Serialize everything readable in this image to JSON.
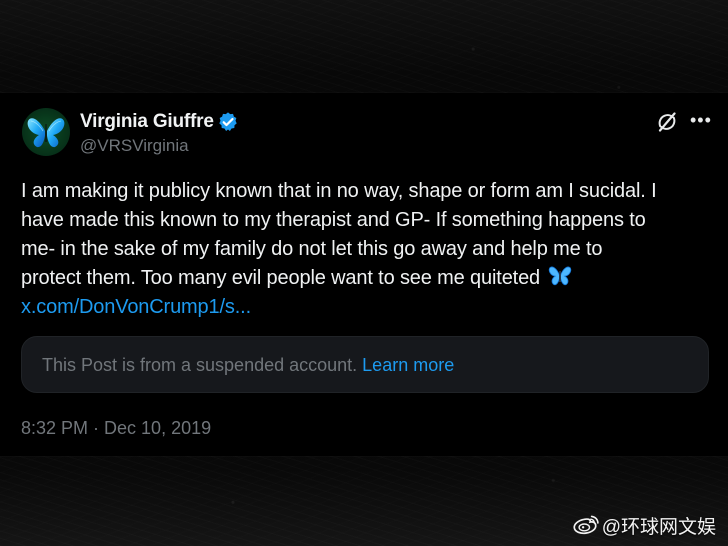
{
  "post": {
    "author": {
      "name": "Virginia Giuffre",
      "handle": "@VRSVirginia",
      "verified": true,
      "avatar_icon": "blue-butterfly-avatar"
    },
    "text_lines": [
      "I am making it publicy known that in no way, shape or form am I sucidal. I",
      "have made this known to my therapist and GP- If something happens to",
      "me- in the sake of my family do not let this go away and help me to",
      "protect them. Too many evil people want to see me quiteted"
    ],
    "link_text": "x.com/DonVonCrump1/s...",
    "quoted_notice": {
      "text": "This Post is from a suspended account.",
      "learn_more": "Learn more"
    },
    "timestamp": "8:32 PM · Dec 10, 2019"
  },
  "watermark": {
    "text": "@环球网文娱",
    "icon": "weibo-icon"
  },
  "icons": {
    "verified": "verified-badge-icon",
    "grok": "grok-icon",
    "more": "more-options-icon",
    "emoji": "butterfly-emoji-icon"
  },
  "colors": {
    "background": "#000000",
    "text_primary": "#e7e9ea",
    "text_secondary": "#71767b",
    "link": "#1d9bf0",
    "card": "#16181c"
  }
}
